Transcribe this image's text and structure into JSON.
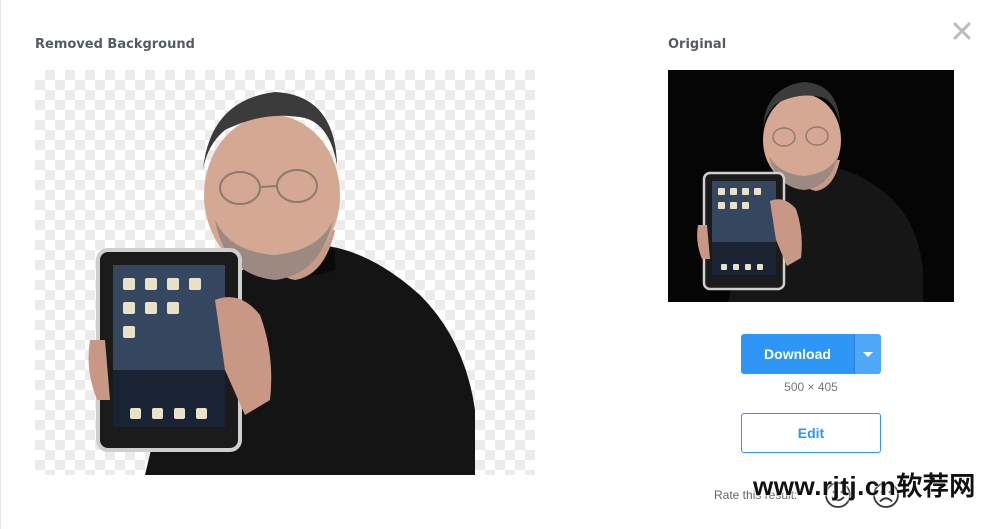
{
  "headings": {
    "removed": "Removed Background",
    "original": "Original"
  },
  "images": {
    "result_alt": "person-holding-tablet-cutout",
    "original_alt": "person-holding-tablet-original"
  },
  "actions": {
    "download_label": "Download",
    "dimensions": "500 × 405",
    "edit_label": "Edit"
  },
  "rating": {
    "label": "Rate this result:"
  },
  "watermark": "www.rjtj.cn软荐网",
  "colors": {
    "accent": "#2e96f4",
    "checker": "#ececec",
    "original_bg": "#050505"
  },
  "icons": [
    "close-icon",
    "caret-down-icon",
    "happy-face-icon",
    "sad-face-icon"
  ]
}
